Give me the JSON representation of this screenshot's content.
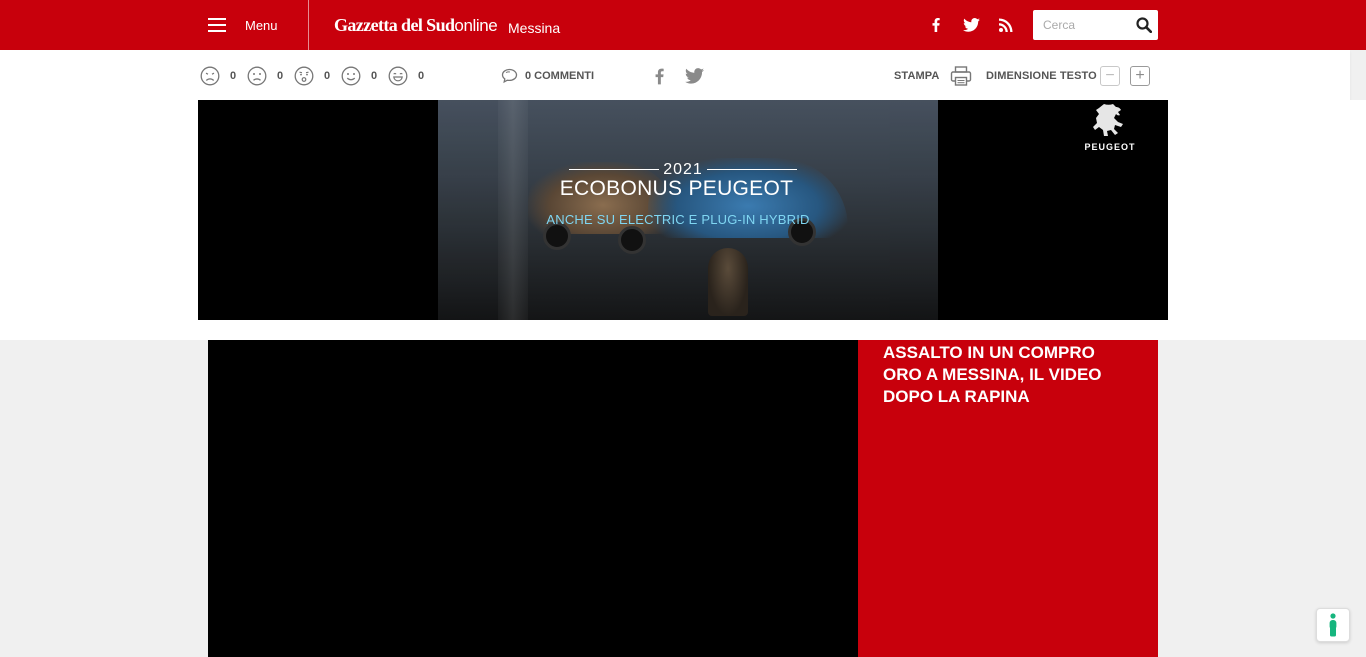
{
  "header": {
    "menu_label": "Menu",
    "logo_main": "Gazzetta del Sud",
    "logo_online": "online",
    "city": "Messina",
    "search_placeholder": "Cerca",
    "brand_color": "#c8000c"
  },
  "toolbar": {
    "reactions": [
      {
        "icon": "very-sad-face-icon",
        "count": "0"
      },
      {
        "icon": "sad-face-icon",
        "count": "0"
      },
      {
        "icon": "surprised-face-icon",
        "count": "0"
      },
      {
        "icon": "smile-face-icon",
        "count": "0"
      },
      {
        "icon": "laugh-face-icon",
        "count": "0"
      }
    ],
    "comments_label": "0 COMMENTI",
    "print_label": "STAMPA",
    "text_size_label": "DIMENSIONE TESTO",
    "decrease_label": "−",
    "increase_label": "+"
  },
  "ad": {
    "year": "2021",
    "title": "ECOBONUS PEUGEOT",
    "subtitle": "ANCHE SU ELECTRIC E PLUG-IN HYBRID",
    "brand": "PEUGEOT",
    "subtitle_color": "#7fd6f2"
  },
  "video": {
    "title": "ASSALTO IN UN COMPRO ORO A MESSINA, IL VIDEO DOPO LA RAPINA"
  }
}
